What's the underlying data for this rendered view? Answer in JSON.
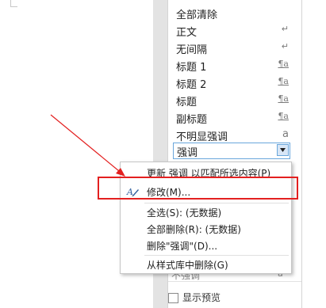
{
  "styles_pane": {
    "items": [
      {
        "label": "全部清除",
        "symbol": "",
        "symbol_kind": "none"
      },
      {
        "label": "正文",
        "symbol": "↵",
        "symbol_kind": "paragraph"
      },
      {
        "label": "无间隔",
        "symbol": "↵",
        "symbol_kind": "paragraph"
      },
      {
        "label": "标题 1",
        "symbol": "¶a",
        "symbol_kind": "linked"
      },
      {
        "label": "标题 2",
        "symbol": "¶a",
        "symbol_kind": "linked"
      },
      {
        "label": "标题",
        "symbol": "¶a",
        "symbol_kind": "linked"
      },
      {
        "label": "副标题",
        "symbol": "¶a",
        "symbol_kind": "linked"
      },
      {
        "label": "不明显强调",
        "symbol": "a",
        "symbol_kind": "character"
      }
    ],
    "selected": {
      "label": "强调"
    },
    "ghost_item": {
      "label": "不强调",
      "symbol": "a"
    },
    "show_preview_label": "显示预览"
  },
  "context_menu": {
    "items": [
      {
        "label": "更新 强调 以匹配所选内容(P)",
        "icon": "update-style-icon"
      },
      {
        "label": "修改(M)...",
        "icon": "modify-style-icon"
      },
      {
        "label": "全选(S): (无数据)",
        "icon": ""
      },
      {
        "label": "全部删除(R): (无数据)",
        "icon": ""
      },
      {
        "label": "删除\"强调\"(D)...",
        "icon": ""
      },
      {
        "label": "从样式库中删除(G)",
        "icon": ""
      }
    ]
  },
  "colors": {
    "highlight": "#e32020",
    "selection_border": "#6aa7dc",
    "arrow": "#e32020"
  }
}
